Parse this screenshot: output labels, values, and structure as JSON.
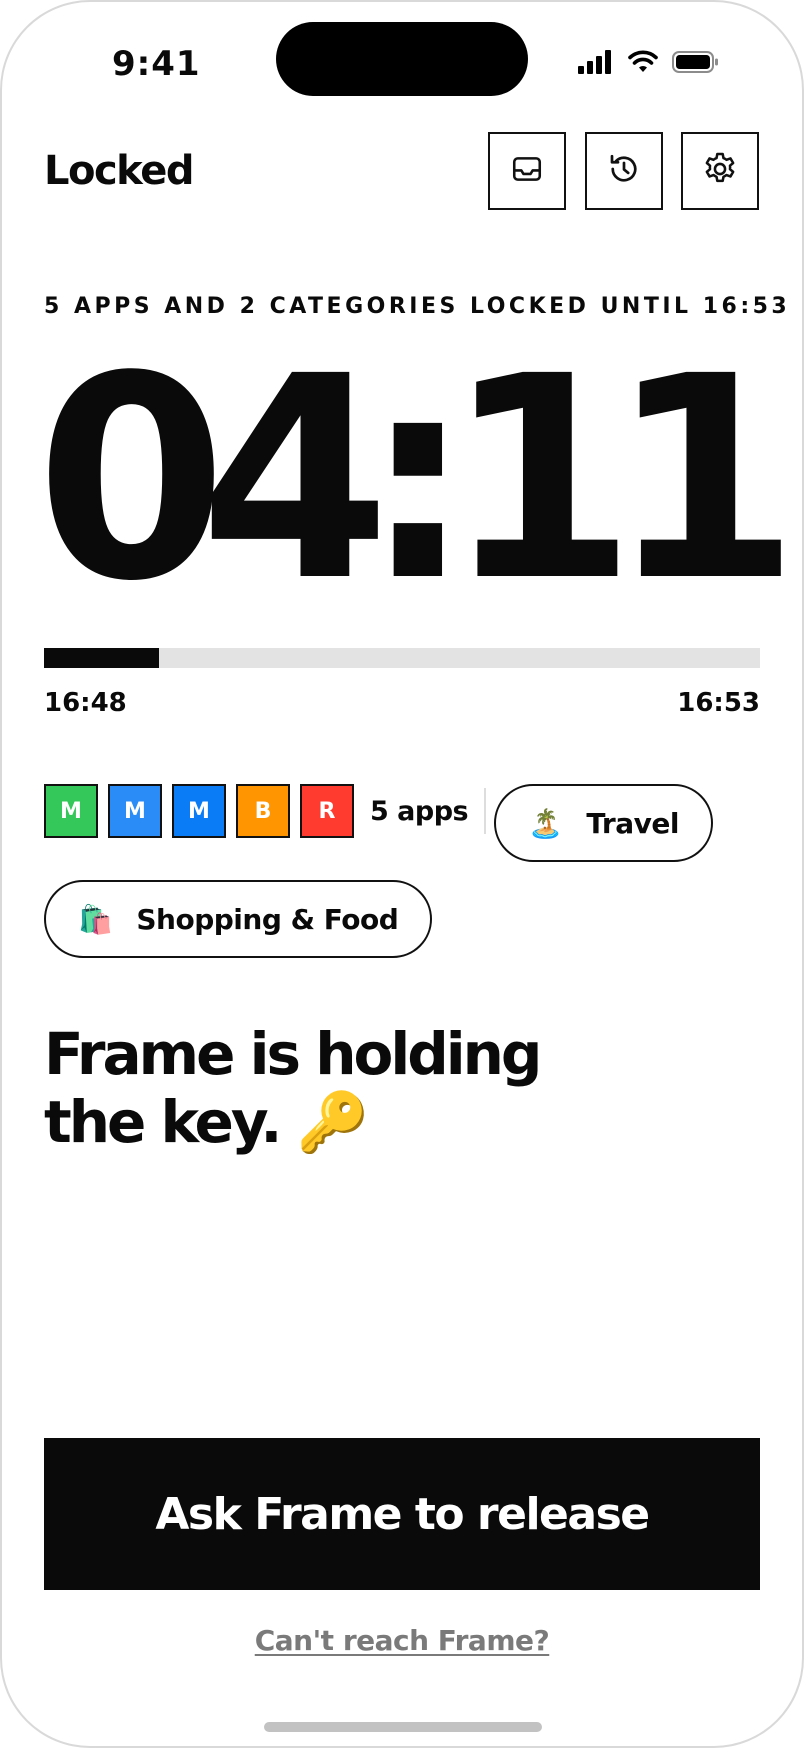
{
  "status_bar": {
    "time": "9:41",
    "icons": [
      "cellular-signal-icon",
      "wifi-icon",
      "battery-icon"
    ]
  },
  "header": {
    "title": "Locked",
    "actions": [
      {
        "icon": "inbox-icon"
      },
      {
        "icon": "history-icon"
      },
      {
        "icon": "gear-icon"
      }
    ]
  },
  "lock": {
    "summary": "5 APPS AND 2 CATEGORIES LOCKED UNTIL 16:53",
    "remaining": "04:11",
    "progress": {
      "fraction": 0.16,
      "start": "16:48",
      "end": "16:53"
    }
  },
  "apps": {
    "tiles": [
      {
        "letter": "M",
        "color": "#34c759"
      },
      {
        "letter": "M",
        "color": "#2a8cf7"
      },
      {
        "letter": "M",
        "color": "#0a7cf5"
      },
      {
        "letter": "B",
        "color": "#ff9500"
      },
      {
        "letter": "R",
        "color": "#ff3b30"
      }
    ],
    "count_label": "5 apps"
  },
  "categories": [
    {
      "emoji": "🏝️",
      "label": "Travel"
    },
    {
      "emoji": "🛍️",
      "label": "Shopping & Food"
    }
  ],
  "message": {
    "line1": "Frame is holding",
    "line2": "the key.",
    "emoji": "🔑"
  },
  "actions": {
    "release_label": "Ask Frame to release",
    "fallback_label": "Can't reach Frame?"
  },
  "colors": {
    "ink": "#0a0a0a",
    "track": "#e3e3e3",
    "link": "#7a7a7a"
  }
}
